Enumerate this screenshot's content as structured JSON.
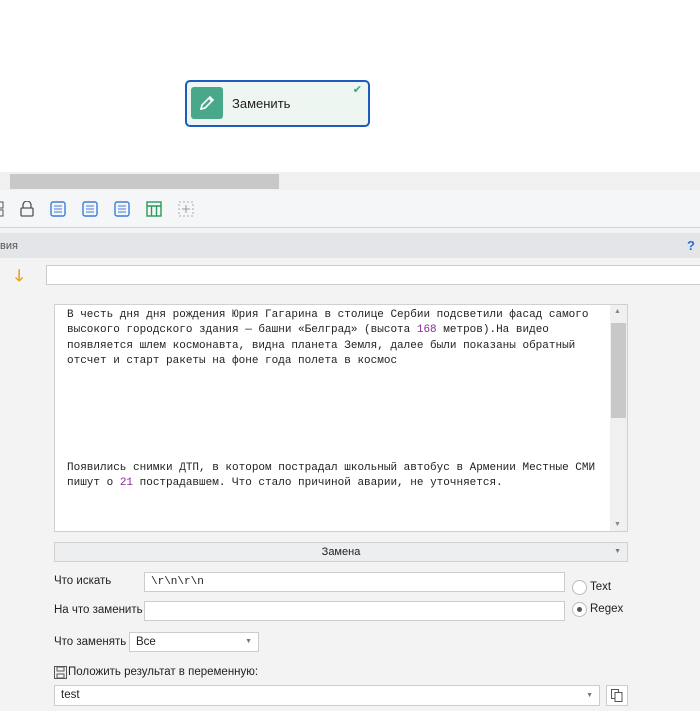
{
  "node": {
    "label": "Заменить",
    "icon": "pencil-icon",
    "status": "check-icon"
  },
  "toolbar": {
    "icons": [
      "link-icon",
      "lock-icon",
      "list-icon",
      "list-icon",
      "list-icon",
      "table-icon",
      "add-icon"
    ]
  },
  "header": {
    "title": "вия",
    "help": "?"
  },
  "text": {
    "p1_a": "В честь дня дня рождения Юрия Гагарина в столице Сербии подсветили фасад самого высокого городского здания — башни «Белград» (высота ",
    "p1_num": "168",
    "p1_b": " метров).На видео появляется шлем космонавта, видна планета Земля, далее были показаны обратный отсчет и старт ракеты на фоне года полета в космос",
    "p2_a": "Появились снимки ДТП, в котором пострадал школьный автобус в Армении Местные СМИ пишут о ",
    "p2_num": "21",
    "p2_b": " пострадавшем. Что стало причиной аварии, не уточняется."
  },
  "form": {
    "mode": "Замена",
    "search_label": "Что искать",
    "search_value": "\\r\\n\\r\\n",
    "replace_label": "На что заменить",
    "replace_value": "",
    "radio_text": "Text",
    "radio_regex": "Regex",
    "what_label": "Что заменять",
    "what_value": "Все",
    "result_label": "Положить результат в переменную:",
    "result_value": "test"
  },
  "colors": {
    "accent": "#1f5bbf",
    "node_icon": "#4aa88a",
    "arrow": "#f0a020"
  }
}
